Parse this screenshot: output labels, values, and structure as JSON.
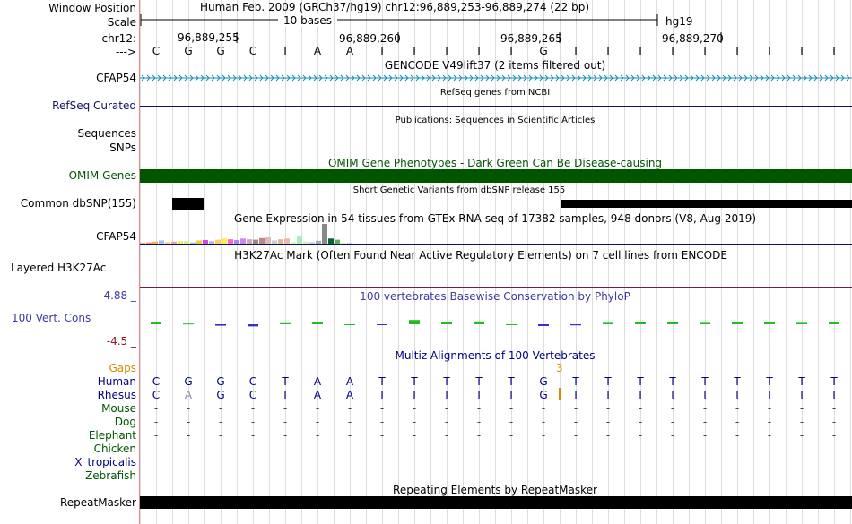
{
  "labels": {
    "window_position": "Window Position",
    "scale": "Scale",
    "chr": "chr12:",
    "arrow": "--->",
    "cfap54": "CFAP54",
    "refseq": "RefSeq Curated",
    "sequences": "Sequences",
    "snps": "SNPs",
    "omim": "OMIM Genes",
    "dbsnp": "Common dbSNP(155)",
    "gtex": "CFAP54",
    "h3k27ac": "Layered H3K27Ac",
    "cons_max": "4.88 _",
    "cons": "100 Vert. Cons",
    "cons_min": "-4.5 _",
    "gaps": "Gaps",
    "species": [
      {
        "name": "Human",
        "color": "#000080"
      },
      {
        "name": "Rhesus",
        "color": "#000080"
      },
      {
        "name": "Mouse",
        "color": "#005500"
      },
      {
        "name": "Dog",
        "color": "#005500"
      },
      {
        "name": "Elephant",
        "color": "#005500"
      },
      {
        "name": "Chicken",
        "color": "#005500"
      },
      {
        "name": "X_tropicalis",
        "color": "#000080"
      },
      {
        "name": "Zebrafish",
        "color": "#005500"
      }
    ],
    "repeatmasker": "RepeatMasker"
  },
  "header": {
    "assembly": "Human Feb. 2009 (GRCh37/hg19)   chr12:96,889,253-96,889,274 (22 bp)",
    "scale_text": "10 bases",
    "scale_db": "hg19",
    "positions": [
      "96,889,255",
      "96,889,260",
      "96,889,265",
      "96,889,270"
    ]
  },
  "sequence": [
    "C",
    "G",
    "G",
    "C",
    "T",
    "A",
    "A",
    "T",
    "T",
    "T",
    "T",
    "T",
    "G",
    "T",
    "T",
    "T",
    "T",
    "T",
    "T",
    "T",
    "T",
    "T"
  ],
  "rhesus": [
    "C",
    "A",
    "G",
    "C",
    "T",
    "A",
    "A",
    "T",
    "T",
    "T",
    "T",
    "T",
    "G",
    "T",
    "T",
    "T",
    "T",
    "T",
    "T",
    "T",
    "T",
    "T"
  ],
  "gap_count": "3",
  "tracks": {
    "gencode": "GENCODE V49lift37 (2 items filtered out)",
    "refseq": "RefSeq genes from NCBI",
    "publications": "Publications: Sequences in Scientific Articles",
    "omim": "OMIM Gene Phenotypes - Dark Green Can Be Disease-causing",
    "dbsnp": "Short Genetic Variants from dbSNP release 155",
    "gtex": "Gene Expression in 54 tissues from GTEx RNA-seq of 17382 samples, 948 donors (V8, Aug 2019)",
    "h3k27ac": "H3K27Ac Mark (Often Found Near Active Regulatory Elements) on 7 cell lines from ENCODE",
    "phylop": "100 vertebrates Basewise Conservation by PhyloP",
    "multiz": "Multiz Alignments of 100 Vertebrates",
    "repeatmasker": "Repeating Elements by RepeatMasker"
  },
  "colors": {
    "cfap54": "#1a8fb4",
    "refseq": "#101060",
    "omim": "#005500",
    "gap": "#d98b00",
    "cons_axis": "#3a3a9f",
    "cons_min": "#8b1a1a",
    "grid": "#dddddd"
  },
  "gtex_bars": [
    {
      "h": 0.05,
      "c": "#ffaa66"
    },
    {
      "h": 0.06,
      "c": "#ff8888"
    },
    {
      "h": 0.1,
      "c": "#ffaa44"
    },
    {
      "h": 0.16,
      "c": "#aabbee"
    },
    {
      "h": 0.08,
      "c": "#ffcc88"
    },
    {
      "h": 0.1,
      "c": "#ddaaaa"
    },
    {
      "h": 0.14,
      "c": "#eeee66"
    },
    {
      "h": 0.12,
      "c": "#ccee88"
    },
    {
      "h": 0.06,
      "c": "#aabbcc"
    },
    {
      "h": 0.16,
      "c": "#eecc44"
    },
    {
      "h": 0.18,
      "c": "#dd44dd"
    },
    {
      "h": 0.12,
      "c": "#bbaaee"
    },
    {
      "h": 0.2,
      "c": "#ffcc66"
    },
    {
      "h": 0.26,
      "c": "#ffee44"
    },
    {
      "h": 0.22,
      "c": "#ff66cc"
    },
    {
      "h": 0.18,
      "c": "#aa88ff"
    },
    {
      "h": 0.26,
      "c": "#cc88ee"
    },
    {
      "h": 0.22,
      "c": "#ccaaaa"
    },
    {
      "h": 0.2,
      "c": "#998888"
    },
    {
      "h": 0.28,
      "c": "#bb8888"
    },
    {
      "h": 0.32,
      "c": "#ddbbbb"
    },
    {
      "h": 0.16,
      "c": "#cccccc"
    },
    {
      "h": 0.22,
      "c": "#ddbb99"
    },
    {
      "h": 0.26,
      "c": "#eebbaa"
    },
    {
      "h": 0.1,
      "c": "#ccffcc"
    },
    {
      "h": 0.36,
      "c": "#aaeebb"
    },
    {
      "h": 0.12,
      "c": "#ddeecc"
    },
    {
      "h": 0.08,
      "c": "#ccccdd"
    },
    {
      "h": 0.14,
      "c": "#aaaaaa"
    },
    {
      "h": 1.0,
      "c": "#888888"
    },
    {
      "h": 0.26,
      "c": "#006633"
    },
    {
      "h": 0.2,
      "c": "#66aa66"
    },
    {
      "h": 0.06,
      "c": "#eeeeaa"
    },
    {
      "h": 0.04,
      "c": "#ccccee"
    }
  ],
  "phylop_values": [
    0.05,
    0.02,
    -0.04,
    -0.06,
    0.03,
    0.06,
    0.0,
    -0.02,
    0.12,
    0.06,
    0.08,
    0.0,
    -0.05,
    -0.03,
    0.04,
    0.06,
    0.05,
    0.04,
    0.06,
    0.05,
    0.04,
    0.05
  ]
}
